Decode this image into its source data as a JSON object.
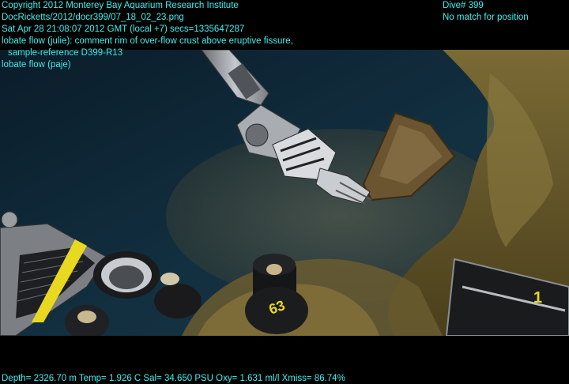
{
  "overlay": {
    "copyright": "Copyright 2012 Monterey Bay Aquarium Research Institute",
    "filename": "DocRicketts/2012/docr399/07_18_02_23.png",
    "datetime": "Sat Apr 28 21:08:07 2012 GMT (local +7)  secs=1335647287",
    "annotation_1": "lobate flow (julie): comment rim of over-flow crust above eruptive fissure,",
    "annotation_1_cont": "sample-reference D399-R13",
    "annotation_2": "lobate flow (paje)",
    "dive": "Dive# 399",
    "position_status": "No match for position",
    "telemetry": "Depth= 2326.70 m  Temp= 1.926 C  Sal= 34.650 PSU  Oxy= 1.631 ml/l  Xmiss= 86.74%"
  },
  "scene": {
    "sample_tube_label": "63",
    "tray_label": "1",
    "colors": {
      "water": "#0e2330",
      "sediment": "#5a4a28",
      "rock": "#6b5a2a",
      "arm": "#9a9ea2",
      "overlay_text": "#3ff0f0",
      "tag_yellow": "#e8d820"
    }
  }
}
